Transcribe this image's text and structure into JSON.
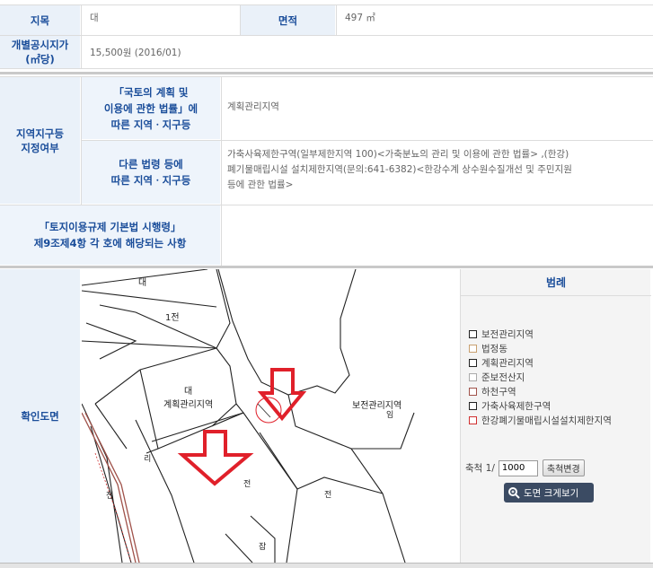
{
  "parcel": {
    "jimok_label": "지목",
    "jimok_value": "대",
    "area_label": "면적",
    "area_value": "497 ㎡",
    "price_label_line1": "개별공시지가",
    "price_label_line2": "(㎡당)",
    "price_value": "15,500원 (2016/01)"
  },
  "zoning": {
    "section_label_line1": "지역지구등",
    "section_label_line2": "지정여부",
    "national_label_line1": "「국토의 계획 및",
    "national_label_line2": "이용에 관한 법률」에",
    "national_label_line3": "따른 지역ㆍ지구등",
    "national_value": "계획관리지역",
    "other_label_line1": "다른 법령 등에",
    "other_label_line2": "따른 지역ㆍ지구등",
    "other_value_line1": "가축사육제한구역(일부제한지역 100)<가축분뇨의 관리 및 이용에 관한 법률> ,(한강)",
    "other_value_line2": "폐기물매립시설 설치제한지역(문의:641-6382)<한강수계 상수원수질개선 및 주민지원",
    "other_value_line3": "등에 관한 법률>",
    "enforcement_label_line1": "「토지이용규제 기본법 시행령」",
    "enforcement_label_line2": "제9조제4항 각 호에 해당되는 사항",
    "enforcement_value": ""
  },
  "map": {
    "section_label": "확인도면",
    "labels": {
      "top_da": "대",
      "jeon_1": "1전",
      "da_center": "대",
      "plan_area": "계획관리지역",
      "conservation_area": "보전관리지역",
      "im": "임",
      "ri": "리",
      "jeon_bottom_center": "전",
      "jeon_right": "전",
      "jeon_left": "전",
      "jip": "잡"
    }
  },
  "legend": {
    "title": "범례",
    "items": [
      {
        "label": "보전관리지역",
        "color": "#222222"
      },
      {
        "label": "법정동",
        "color": "#c8a070"
      },
      {
        "label": "계획관리지역",
        "color": "#222222"
      },
      {
        "label": "준보전산지",
        "color": "#aaaaaa"
      },
      {
        "label": "하천구역",
        "color": "#a0524a"
      },
      {
        "label": "가축사육제한구역",
        "color": "#222222"
      },
      {
        "label": "한강폐기물매립시설설치제한지역",
        "color": "#d03030"
      }
    ],
    "scale_label": "축척 1/",
    "scale_value": "1000",
    "scale_button": "축척변경",
    "zoom_button": "도면 크게보기"
  },
  "colors": {
    "label_text": "#1a4d9a",
    "label_bg": "#eaf1f9",
    "arrow_red": "#e0202a"
  }
}
